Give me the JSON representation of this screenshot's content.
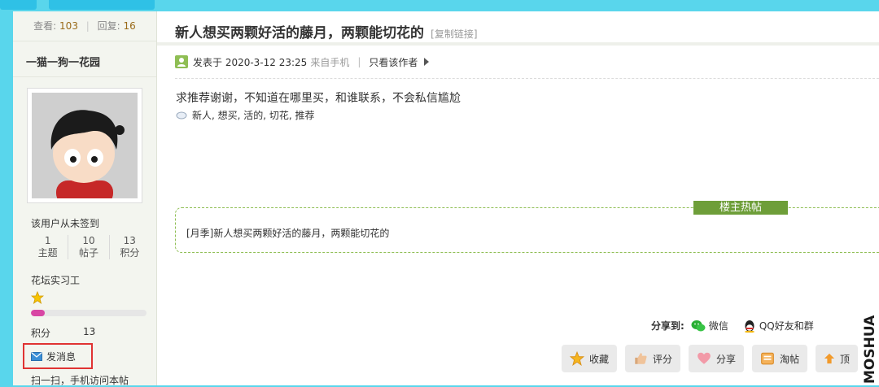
{
  "sidebar": {
    "stats": {
      "views_label": "查看:",
      "views": "103",
      "replies_label": "回复:",
      "replies": "16"
    },
    "username": "一猫一狗一花园",
    "signin_status": "该用户从未签到",
    "counts": [
      {
        "value": "1",
        "label": "主题"
      },
      {
        "value": "10",
        "label": "帖子"
      },
      {
        "value": "13",
        "label": "积分"
      }
    ],
    "rank": "花坛实习工",
    "level_progress": 0.12,
    "score_label": "积分",
    "score_value": "13",
    "message_button": "发消息",
    "scan_text": "扫一扫，手机访问本帖"
  },
  "post": {
    "title": "新人想买两颗好活的藤月，两颗能切花的",
    "copy_link": "[复制链接]",
    "posted_label": "发表于 2020-3-12 23:25",
    "source": "来自手机",
    "author_only": "只看该作者",
    "content": "求推荐谢谢，不知道在哪里买，和谁联系，不会私信尴尬",
    "tags": "新人, 想买, 活的, 切花, 推荐"
  },
  "hot": {
    "title": "楼主热帖",
    "items": [
      "[月季]新人想买两颗好活的藤月，两颗能切花的"
    ]
  },
  "share": {
    "label": "分享到:",
    "wechat": "微信",
    "qq": "QQ好友和群"
  },
  "actions": [
    "收藏",
    "评分",
    "分享",
    "淘帖",
    "顶"
  ],
  "watermark": "MOSHUA",
  "colors": {
    "background": "#59d6ec",
    "accent_green": "#6e9e39",
    "progress_pink": "#d846a4",
    "highlight_red": "#e03333"
  }
}
